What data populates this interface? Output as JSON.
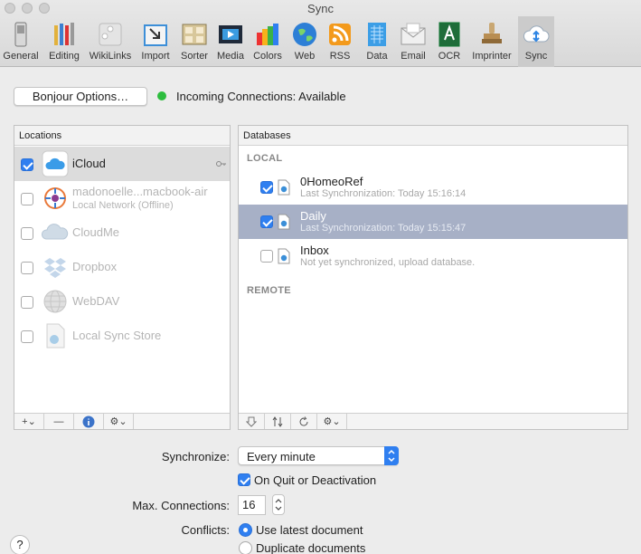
{
  "window": {
    "title": "Sync"
  },
  "toolbar": {
    "items": [
      {
        "label": "General",
        "icon": "switch-icon"
      },
      {
        "label": "Editing",
        "icon": "pencils-icon"
      },
      {
        "label": "WikiLinks",
        "icon": "puzzle-icon"
      },
      {
        "label": "Import",
        "icon": "import-tray-icon"
      },
      {
        "label": "Sorter",
        "icon": "sorter-grid-icon"
      },
      {
        "label": "Media",
        "icon": "media-film-icon"
      },
      {
        "label": "Colors",
        "icon": "color-swatches-icon"
      },
      {
        "label": "Web",
        "icon": "globe-icon"
      },
      {
        "label": "RSS",
        "icon": "rss-icon"
      },
      {
        "label": "Data",
        "icon": "data-sheet-icon"
      },
      {
        "label": "Email",
        "icon": "envelope-icon"
      },
      {
        "label": "OCR",
        "icon": "ocr-letter-icon"
      },
      {
        "label": "Imprinter",
        "icon": "stamp-icon"
      },
      {
        "label": "Sync",
        "icon": "cloud-sync-icon",
        "selected": true
      }
    ]
  },
  "bonjour": {
    "button_label": "Bonjour Options…",
    "status_text": "Incoming Connections: Available",
    "status_color": "#2dbd3e"
  },
  "locations": {
    "header": "Locations",
    "items": [
      {
        "name": "iCloud",
        "subtitle": "",
        "checked": true,
        "enabled": true,
        "icon": "icloud-icon"
      },
      {
        "name": "madonoelle...macbook-air",
        "subtitle": "Local Network (Offline)",
        "checked": false,
        "enabled": false,
        "icon": "bonjour-icon"
      },
      {
        "name": "CloudMe",
        "subtitle": "",
        "checked": false,
        "enabled": false,
        "icon": "cloudme-icon"
      },
      {
        "name": "Dropbox",
        "subtitle": "",
        "checked": false,
        "enabled": false,
        "icon": "dropbox-icon"
      },
      {
        "name": "WebDAV",
        "subtitle": "",
        "checked": false,
        "enabled": false,
        "icon": "webdav-globe-icon"
      },
      {
        "name": "Local Sync Store",
        "subtitle": "",
        "checked": false,
        "enabled": false,
        "icon": "local-store-icon"
      }
    ],
    "footer": [
      "add-menu-icon",
      "remove-icon",
      "info-icon",
      "gear-menu-icon"
    ]
  },
  "databases": {
    "header": "Databases",
    "local_label": "LOCAL",
    "remote_label": "REMOTE",
    "items": [
      {
        "name": "0HomeoRef",
        "subtitle": "Last Synchronization: Today 15:16:14",
        "checked": true,
        "selected": false
      },
      {
        "name": "Daily",
        "subtitle": "Last Synchronization: Today 15:15:47",
        "checked": true,
        "selected": true
      },
      {
        "name": "Inbox",
        "subtitle": "Not yet synchronized, upload database.",
        "checked": false,
        "selected": false
      }
    ],
    "footer": [
      "download-icon",
      "sync-arrows-icon",
      "refresh-icon",
      "gear-menu-icon"
    ]
  },
  "settings": {
    "synchronize_label": "Synchronize:",
    "synchronize_value": "Every minute",
    "on_quit_label": "On Quit or Deactivation",
    "on_quit_checked": true,
    "max_connections_label": "Max. Connections:",
    "max_connections_value": "16",
    "conflicts_label": "Conflicts:",
    "conflict_options": [
      {
        "label": "Use latest document",
        "selected": true
      },
      {
        "label": "Duplicate documents",
        "selected": false
      }
    ]
  },
  "help": {
    "label": "?"
  },
  "colors": {
    "accent": "#2f7ff0",
    "selection": "#a7b0c6"
  }
}
